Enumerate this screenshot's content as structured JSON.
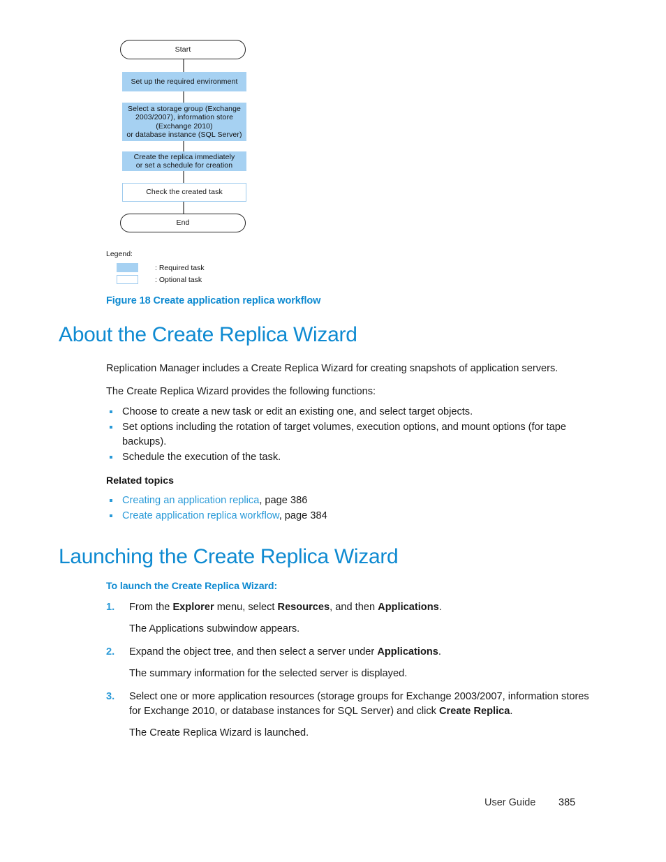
{
  "figure": {
    "nodes": [
      {
        "id": "start",
        "label": "Start",
        "kind": "terminator"
      },
      {
        "id": "setup",
        "label": "Set up the required environment",
        "kind": "required"
      },
      {
        "id": "select",
        "label": "Select a storage group (Exchange\n2003/2007), information store\n(Exchange 2010)\nor database instance (SQL Server)",
        "kind": "required"
      },
      {
        "id": "create",
        "label": "Create the replica immediately\nor set a schedule for creation",
        "kind": "required"
      },
      {
        "id": "check",
        "label": "Check the created task",
        "kind": "optional"
      },
      {
        "id": "end",
        "label": "End",
        "kind": "terminator"
      }
    ],
    "legend": {
      "title": "Legend:",
      "items": [
        {
          "kind": "required",
          "label": ": Required task"
        },
        {
          "kind": "optional",
          "label": ": Optional task"
        }
      ]
    },
    "caption": "Figure 18 Create application replica workflow"
  },
  "section_about": {
    "heading": "About the Create Replica Wizard",
    "intro": "Replication Manager includes a Create Replica Wizard for creating snapshots of application servers.",
    "lead_in": "The Create Replica Wizard provides the following functions:",
    "bullets": [
      "Choose to create a new task or edit an existing one, and select target objects.",
      "Set options including the rotation of target volumes, execution options, and mount options (for tape backups).",
      "Schedule the execution of the task."
    ],
    "related_topics_heading": "Related topics",
    "related_topics": [
      {
        "link": "Creating an application replica",
        "suffix": ", page 386"
      },
      {
        "link": "Create application replica workflow",
        "suffix": ", page 384"
      }
    ]
  },
  "section_launching": {
    "heading": "Launching the Create Replica Wizard",
    "subheading": "To launch the Create Replica Wizard:",
    "steps": [
      {
        "num": "1.",
        "parts": [
          {
            "t": "From the ",
            "b": false
          },
          {
            "t": "Explorer",
            "b": true
          },
          {
            "t": " menu, select ",
            "b": false
          },
          {
            "t": "Resources",
            "b": true
          },
          {
            "t": ", and then ",
            "b": false
          },
          {
            "t": "Applications",
            "b": true
          },
          {
            "t": ".",
            "b": false
          }
        ],
        "result": "The Applications subwindow appears."
      },
      {
        "num": "2.",
        "parts": [
          {
            "t": "Expand the object tree, and then select a server under ",
            "b": false
          },
          {
            "t": "Applications",
            "b": true
          },
          {
            "t": ".",
            "b": false
          }
        ],
        "result": "The summary information for the selected server is displayed."
      },
      {
        "num": "3.",
        "parts": [
          {
            "t": "Select one or more application resources (storage groups for Exchange 2003/2007, information stores for Exchange 2010, or database instances for SQL Server) and click ",
            "b": false
          },
          {
            "t": "Create Replica",
            "b": true
          },
          {
            "t": ".",
            "b": false
          }
        ],
        "result": "The Create Replica Wizard is launched."
      }
    ]
  },
  "footer": {
    "guide": "User Guide",
    "page": "385"
  },
  "colors": {
    "heading_blue": "#0e8ad1",
    "link_blue": "#2a9ad8",
    "required_fill": "#a6d1f2",
    "optional_border": "#9ecbee",
    "connector_gray": "#808080"
  }
}
